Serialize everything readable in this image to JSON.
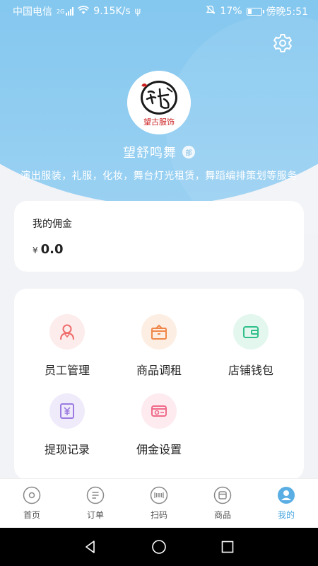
{
  "status_bar": {
    "carrier": "中国电信",
    "network": "2G",
    "speed": "9.15K/s",
    "battery": "17%",
    "time": "傍晚5:51"
  },
  "profile": {
    "logo_caption": "望古服饰",
    "shop_name": "望舒鸣舞",
    "shop_badge": "部",
    "description": "演出服装，礼服，化妆，舞台灯光租赁，舞蹈编排策划等服务"
  },
  "commission": {
    "title": "我的佣金",
    "currency": "¥",
    "amount": "0.0"
  },
  "menu": {
    "items": [
      {
        "label": "员工管理",
        "icon": "staff-icon",
        "bg": "#fdecec",
        "color": "#ef6b6b"
      },
      {
        "label": "商品调租",
        "icon": "box-icon",
        "bg": "#fdeee3",
        "color": "#f0874a"
      },
      {
        "label": "店铺钱包",
        "icon": "wallet-icon",
        "bg": "#e3f7ef",
        "color": "#2fbf8a"
      },
      {
        "label": "提现记录",
        "icon": "withdraw-record-icon",
        "bg": "#f0ebfb",
        "color": "#9b7be0"
      },
      {
        "label": "佣金设置",
        "icon": "commission-settings-icon",
        "bg": "#fdebf0",
        "color": "#ef6b8a"
      }
    ]
  },
  "tabs": [
    {
      "label": "首页",
      "icon": "home-icon"
    },
    {
      "label": "订单",
      "icon": "order-icon"
    },
    {
      "label": "扫码",
      "icon": "scan-icon"
    },
    {
      "label": "商品",
      "icon": "goods-icon"
    },
    {
      "label": "我的",
      "icon": "profile-icon",
      "active": true
    }
  ],
  "colors": {
    "header": "#6bbbec",
    "accent": "#4ea8e0"
  }
}
